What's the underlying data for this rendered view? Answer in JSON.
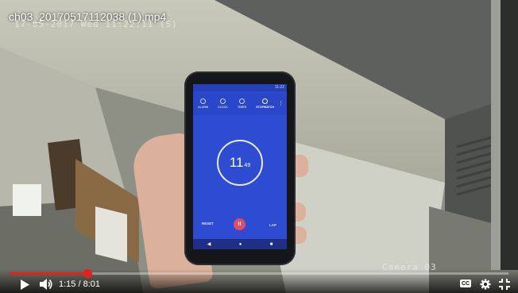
{
  "video": {
    "title": "ch03_20170517112038 (1).mp4",
    "timestamp_overlay": "17-05-2017 Wed 11:22:11 (S)",
    "camera_label": "Camera 03"
  },
  "phone": {
    "status_time": "11:22",
    "tabs": [
      {
        "label": "ALARM",
        "icon": "alarm-icon",
        "active": false
      },
      {
        "label": "CLOCK",
        "icon": "clock-icon",
        "active": false
      },
      {
        "label": "TIMER",
        "icon": "timer-icon",
        "active": false
      },
      {
        "label": "STOPWATCH",
        "icon": "stopwatch-icon",
        "active": true
      }
    ],
    "stopwatch": {
      "seconds": "11",
      "hundredths": "49"
    },
    "reset_label": "RESET",
    "lap_label": "LAP",
    "pause_glyph": "II",
    "nav": {
      "back": "◀",
      "home": "●",
      "recents": "■"
    }
  },
  "controls": {
    "current_time": "1:15",
    "duration": "8:01",
    "time_display": "1:15 / 8:01",
    "progress_fraction": 0.156,
    "cc_label": "CC",
    "accent_color": "#e62117"
  }
}
